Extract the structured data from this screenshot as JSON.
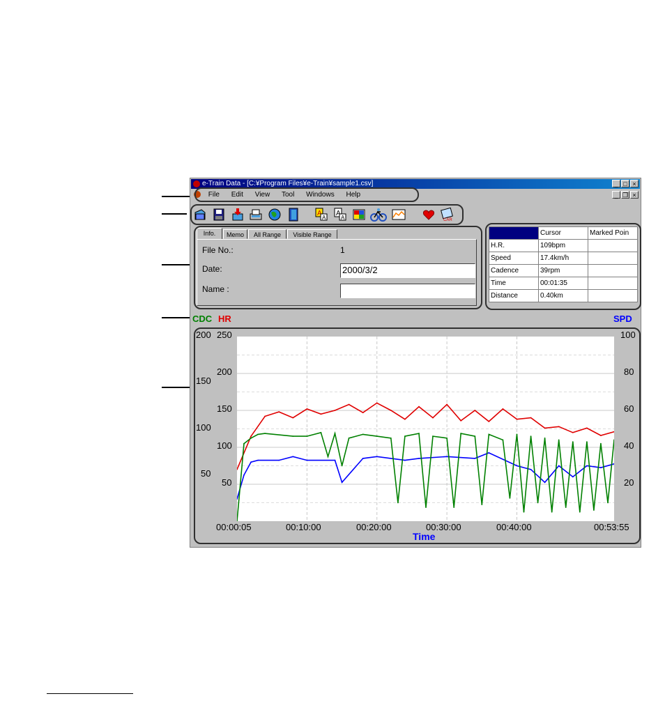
{
  "window": {
    "title": "e-Train Data - [C:¥Program Files¥e-Train¥sample1.csv]",
    "menus": [
      "File",
      "Edit",
      "View",
      "Tool",
      "Windows",
      "Help"
    ],
    "toolbar_icons": [
      "open-file-icon",
      "save-icon",
      "download-icon",
      "print-icon",
      "globe-icon",
      "door-icon",
      "format-a-icon",
      "format-b-icon",
      "grid-icon",
      "bicycle-icon",
      "graph-icon",
      "heart-icon",
      "calendar-icon"
    ]
  },
  "tabs": [
    "Info.",
    "Memo",
    "All Range",
    "Visible Range"
  ],
  "info": {
    "file_no_label": "File No.:",
    "file_no_value": "1",
    "date_label": "Date:",
    "date_value": "2000/3/2",
    "name_label": "Name :",
    "name_value": ""
  },
  "stats": {
    "headers": [
      "",
      "Cursor",
      "Marked Poin"
    ],
    "rows": [
      {
        "label": "H.R.",
        "cursor": "109bpm",
        "marked": ""
      },
      {
        "label": "Speed",
        "cursor": "17.4km/h",
        "marked": ""
      },
      {
        "label": "Cadence",
        "cursor": "39rpm",
        "marked": ""
      },
      {
        "label": "Time",
        "cursor": "00:01:35",
        "marked": ""
      },
      {
        "label": "Distance",
        "cursor": "0.40km",
        "marked": ""
      }
    ]
  },
  "colors": {
    "cdc": "#008000",
    "hr": "#e00000",
    "spd": "#0000ff",
    "header_cell": "#000080"
  },
  "chart_data": {
    "type": "line",
    "xlabel": "Time",
    "x_ticks": [
      "00:00:05",
      "00:10:00",
      "00:20:00",
      "00:30:00",
      "00:40:00",
      "00:53:55"
    ],
    "xlim": [
      "00:00:05",
      "00:53:55"
    ],
    "labels": {
      "cdc": "CDC",
      "hr": "HR",
      "spd": "SPD"
    },
    "left_axes": [
      {
        "name": "CDC",
        "ticks": [
          "200",
          "150",
          "100",
          "50"
        ],
        "range": [
          0,
          200
        ]
      },
      {
        "name": "HR",
        "ticks": [
          "250",
          "200",
          "150",
          "100",
          "50"
        ],
        "range": [
          0,
          250
        ]
      }
    ],
    "right_axis": {
      "name": "SPD",
      "ticks": [
        "100",
        "80",
        "60",
        "40",
        "20"
      ],
      "range": [
        0,
        100
      ]
    },
    "grid": true,
    "series": [
      {
        "name": "HR",
        "axis": "hr",
        "x_minutes": [
          0,
          2,
          4,
          6,
          8,
          10,
          12,
          14,
          16,
          18,
          20,
          22,
          24,
          26,
          28,
          30,
          32,
          34,
          36,
          38,
          40,
          42,
          44,
          46,
          48,
          50,
          52,
          53.9
        ],
        "values": [
          70,
          115,
          142,
          148,
          140,
          152,
          145,
          150,
          158,
          147,
          160,
          150,
          138,
          155,
          140,
          158,
          136,
          150,
          135,
          152,
          138,
          140,
          126,
          128,
          120,
          126,
          116,
          121
        ]
      },
      {
        "name": "SPD",
        "axis": "spd",
        "x_minutes": [
          0,
          1,
          2,
          3,
          6,
          8,
          10,
          14,
          15,
          18,
          20,
          24,
          26,
          30,
          34,
          36,
          40,
          42,
          44,
          46,
          48,
          50,
          52,
          53.9
        ],
        "values": [
          12,
          25,
          32,
          33,
          33,
          35,
          33,
          33,
          21,
          34,
          35,
          33,
          34,
          35,
          34,
          37,
          30,
          28,
          21,
          30,
          24,
          30,
          29,
          31
        ]
      },
      {
        "name": "CDC",
        "axis": "cdc",
        "x_minutes": [
          0,
          1,
          2,
          3,
          4,
          8,
          10,
          12,
          13,
          14,
          15,
          16,
          18,
          20,
          22,
          23,
          24,
          26,
          27,
          28,
          30,
          31,
          32,
          34,
          35,
          36,
          38,
          39,
          40,
          41,
          42,
          43,
          44,
          45,
          46,
          47,
          48,
          49,
          50,
          51,
          52,
          53,
          53.9
        ],
        "values": [
          0,
          84,
          90,
          94,
          95,
          92,
          92,
          96,
          70,
          95,
          60,
          90,
          94,
          92,
          90,
          20,
          92,
          95,
          15,
          92,
          90,
          15,
          95,
          92,
          18,
          94,
          88,
          25,
          94,
          10,
          92,
          20,
          90,
          10,
          88,
          15,
          86,
          10,
          86,
          12,
          84,
          20,
          88
        ]
      }
    ]
  }
}
